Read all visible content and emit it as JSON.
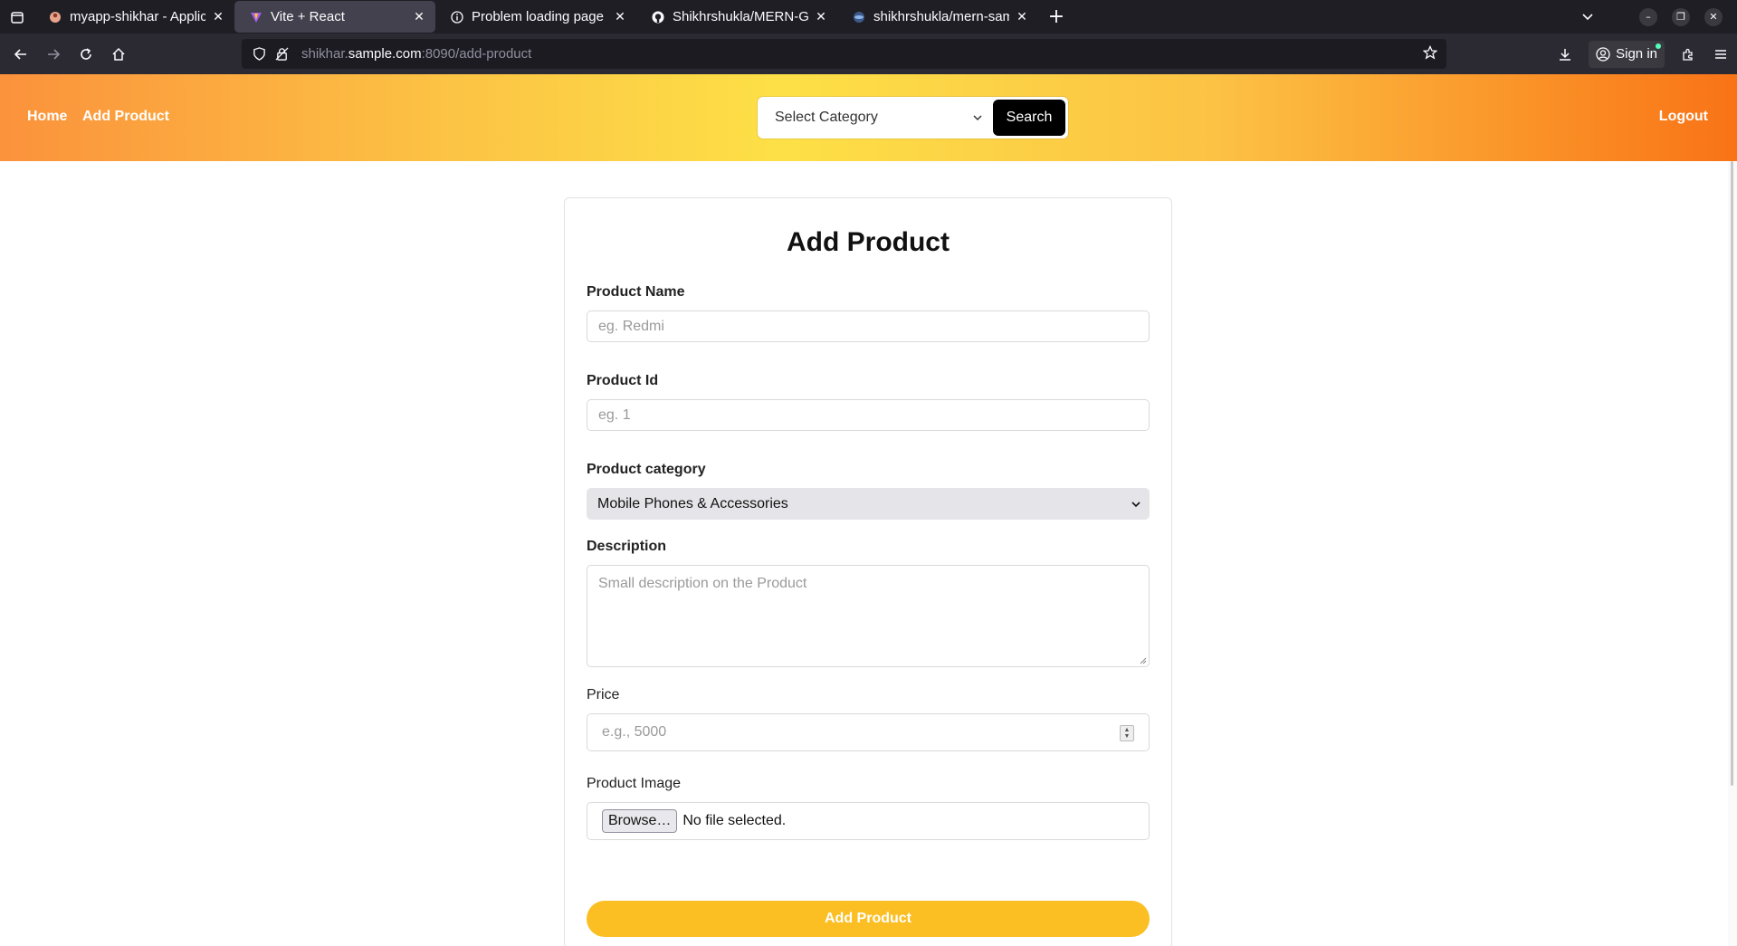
{
  "browser": {
    "tabs": [
      {
        "title": "myapp-shikhar - Applicati",
        "active": false
      },
      {
        "title": "Vite + React",
        "active": true
      },
      {
        "title": "Problem loading page",
        "active": false
      },
      {
        "title": "Shikhrshukla/MERN-GitOp",
        "active": false
      },
      {
        "title": "shikhrshukla/mern-sampl",
        "active": false
      }
    ],
    "url_prefix": "shikhar.",
    "url_host": "sample.com",
    "url_suffix": ":8090/add-product",
    "signin_label": "Sign in"
  },
  "header": {
    "home": "Home",
    "add_product": "Add Product",
    "category_placeholder": "Select Category",
    "search": "Search",
    "logout": "Logout"
  },
  "form": {
    "title": "Add Product",
    "product_name_label": "Product Name",
    "product_name_placeholder": "eg. Redmi",
    "product_id_label": "Product Id",
    "product_id_placeholder": "eg. 1",
    "category_label": "Product category",
    "category_value": "Mobile Phones & Accessories",
    "description_label": "Description",
    "description_placeholder": "Small description on the Product",
    "price_label": "Price",
    "price_placeholder": "e.g., 5000",
    "image_label": "Product Image",
    "browse_label": "Browse…",
    "file_status": "No file selected.",
    "submit_label": "Add Product"
  },
  "colors": {
    "accent": "#fbbf24",
    "header_gradient_start": "#fb923c",
    "header_gradient_end": "#f97316"
  }
}
